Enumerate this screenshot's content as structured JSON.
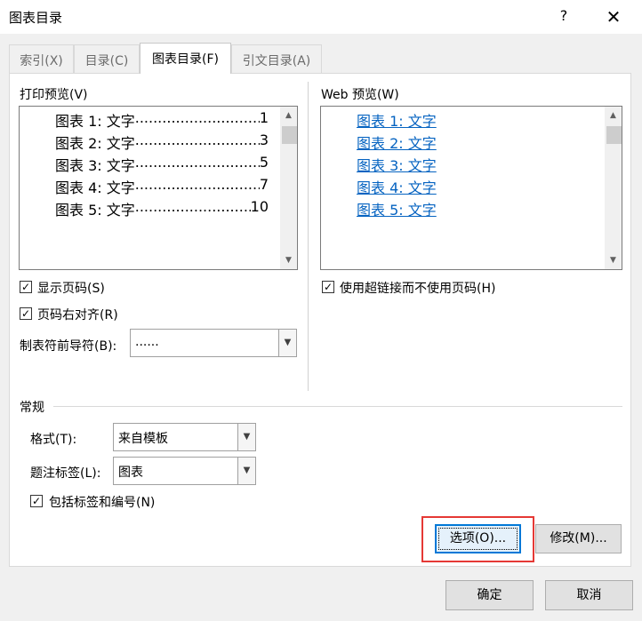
{
  "window": {
    "title": "图表目录",
    "help_label": "?",
    "close_label": "✕"
  },
  "tabs": [
    {
      "label": "索引(X)",
      "active": false
    },
    {
      "label": "目录(C)",
      "active": false
    },
    {
      "label": "图表目录(F)",
      "active": true
    },
    {
      "label": "引文目录(A)",
      "active": false
    }
  ],
  "print_preview": {
    "label": "打印预览(V)",
    "rows": [
      {
        "entry": "图表 1: 文字",
        "page": "1"
      },
      {
        "entry": "图表 2: 文字",
        "page": "3"
      },
      {
        "entry": "图表 3: 文字",
        "page": "5"
      },
      {
        "entry": "图表 4: 文字",
        "page": "7"
      },
      {
        "entry": "图表 5: 文字",
        "page": "10"
      }
    ],
    "leader_text": "............................................................................"
  },
  "web_preview": {
    "label": "Web 预览(W)",
    "rows": [
      "图表 1: 文字",
      "图表 2: 文字",
      "图表 3: 文字",
      "图表 4: 文字",
      "图表 5: 文字"
    ]
  },
  "options": {
    "show_page_numbers": {
      "label": "显示页码(S)",
      "checked": true
    },
    "right_align": {
      "label": "页码右对齐(R)",
      "checked": true
    },
    "use_hyperlinks": {
      "label": "使用超链接而不使用页码(H)",
      "checked": true
    },
    "tab_leader": {
      "label": "制表符前导符(B):",
      "value": "......"
    }
  },
  "general": {
    "section_label": "常规",
    "format": {
      "label": "格式(T):",
      "value": "来自模板"
    },
    "caption_label": {
      "label": "题注标签(L):",
      "value": "图表"
    },
    "include_label": {
      "label": "包括标签和编号(N)",
      "checked": true
    }
  },
  "buttons": {
    "options": "选项(O)...",
    "modify": "修改(M)...",
    "ok": "确定",
    "cancel": "取消"
  },
  "icons": {
    "check": "✓",
    "dropdown": "chevron-down-icon",
    "scroll_up": "scroll-up-icon",
    "scroll_down": "scroll-down-icon"
  },
  "colors": {
    "hyperlink": "#0563c1",
    "focus_border": "#0078d7",
    "annotation_box": "#e53935"
  }
}
